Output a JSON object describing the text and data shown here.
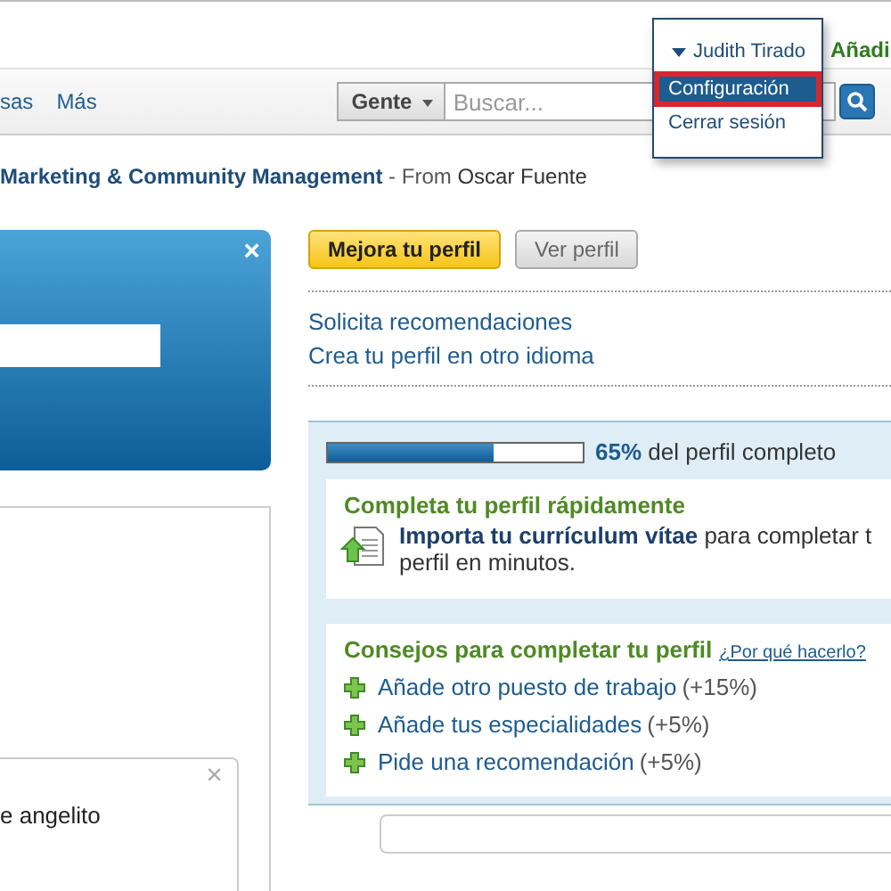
{
  "nav": {
    "items": [
      "sas",
      "Más"
    ],
    "search": {
      "scope": "Gente",
      "placeholder": "Buscar..."
    }
  },
  "account_menu": {
    "user": "Judith Tirado",
    "items": [
      {
        "label": "Configuración",
        "selected": true
      },
      {
        "label": "Cerrar sesión",
        "selected": false
      }
    ]
  },
  "add_link": "Añadi",
  "headline": {
    "group": "Marketing & Community Management",
    "separator": " - From ",
    "author": "Oscar Fuente"
  },
  "notice_card": {
    "close": "×"
  },
  "update_card": {
    "close": "×",
    "text": "e angelito"
  },
  "profile_buttons": [
    {
      "label": "Mejora tu perfil",
      "kind": "primary"
    },
    {
      "label": "Ver perfil",
      "kind": "secondary"
    }
  ],
  "profile_links": [
    "Solicita recomendaciones",
    "Crea tu perfil en otro idioma"
  ],
  "completeness": {
    "level": 0.65,
    "text": "**65%** del perfil completo"
  },
  "quick_complete": {
    "title": "Completa tu perfil rápidamente",
    "lines": [
      "**Importa tu currículum vítae** para completar t",
      "perfil en minutos."
    ]
  },
  "tips": {
    "title": "Consejos para completar tu perfil",
    "why_link": "¿Por qué hacerlo?",
    "items": [
      {
        "label": "Añade otro puesto de trabajo",
        "gain": "(+15%)"
      },
      {
        "label": "Añade tus especialidades",
        "gain": "(+5%)"
      },
      {
        "label": "Pide una recomendación",
        "gain": "(+5%)"
      }
    ]
  }
}
